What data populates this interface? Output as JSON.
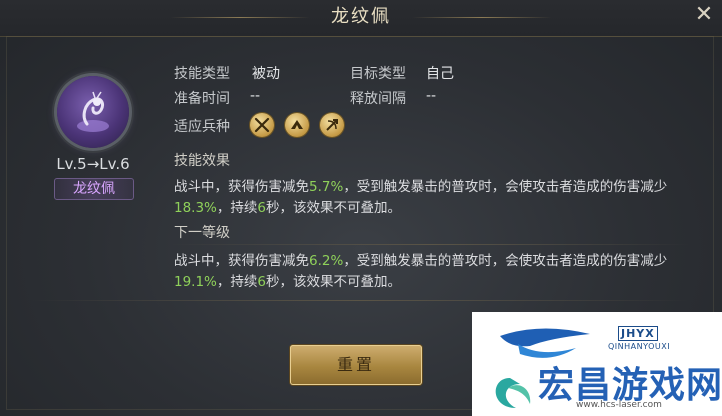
{
  "dialog": {
    "title": "龙纹佩",
    "close_glyph": "✕"
  },
  "item": {
    "icon": "dragon-pendant-icon",
    "level_text": "Lv.5→Lv.6",
    "name": "龙纹佩"
  },
  "skill": {
    "type_label": "技能类型",
    "type_value": "被动",
    "target_label": "目标类型",
    "target_value": "自己",
    "prep_label": "准备时间",
    "prep_value": "--",
    "interval_label": "释放间隔",
    "interval_value": "--",
    "units_label": "适应兵种",
    "units": [
      "crossed-swords-icon",
      "cavalry-icon",
      "archer-icon"
    ]
  },
  "effect": {
    "title": "技能效果",
    "p1": "战斗中，获得伤害减免",
    "v1": "5.7%",
    "p2": "，受到触发暴击的普攻时，会使攻击者造成的伤害减少",
    "v2": "18.3%",
    "p3": "，持续",
    "v3": "6",
    "p4": "秒，该效果不可叠加。"
  },
  "next_level": {
    "title": "下一等级",
    "p1": "战斗中，获得伤害减免",
    "v1": "6.2%",
    "p2": "，受到触发暴击的普攻时，会使攻击者造成的伤害减少",
    "v2": "19.1%",
    "p3": "，持续",
    "v3": "6",
    "p4": "秒，该效果不可叠加。"
  },
  "actions": {
    "reset_label": "重置"
  },
  "watermark": {
    "code": "JHYX",
    "pinyin": "QINHANYOUXI",
    "site_name": "宏昌游戏网",
    "url": "www.hcs-laser.com"
  },
  "colors": {
    "highlight": "#8fd15a",
    "name_purple": "#d9a6ff",
    "gold": "#c59a45"
  }
}
